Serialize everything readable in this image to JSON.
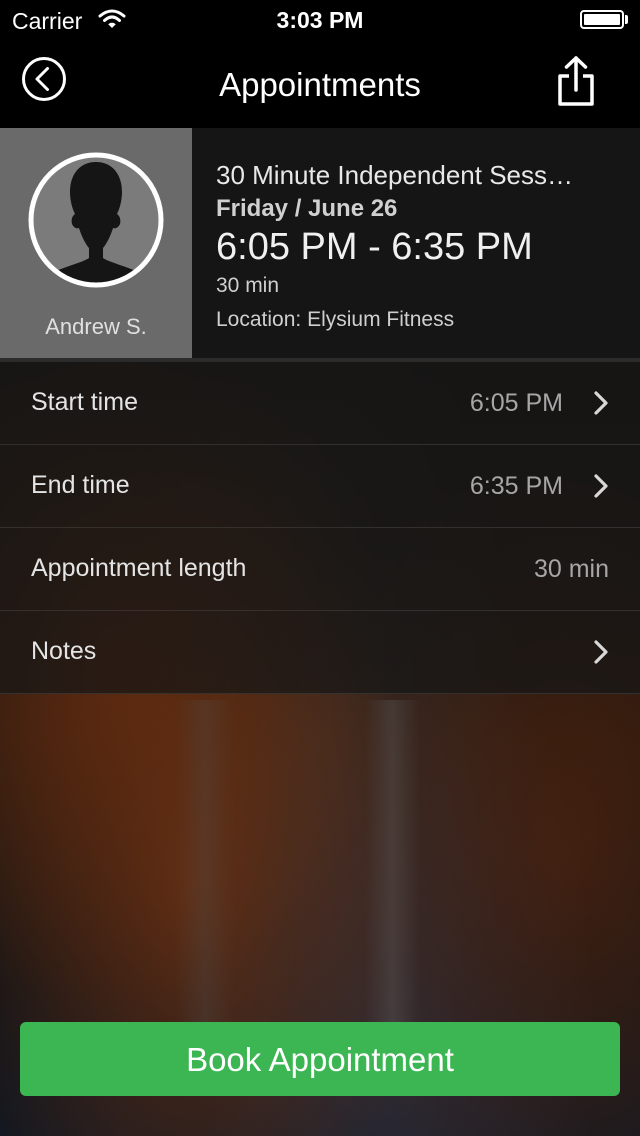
{
  "status_bar": {
    "carrier": "Carrier",
    "time": "3:03 PM"
  },
  "nav": {
    "title": "Appointments",
    "back_icon": "circle-chevron-left-icon",
    "share_icon": "share-icon"
  },
  "appointment": {
    "trainer_name": "Andrew S.",
    "title": "30 Minute Independent Sess…",
    "date": "Friday / June 26",
    "time_range": "6:05 PM - 6:35 PM",
    "length": "30 min",
    "location": "Location: Elysium Fitness"
  },
  "details": [
    {
      "label": "Start time",
      "value": "6:05 PM",
      "has_chevron": true
    },
    {
      "label": "End time",
      "value": "6:35 PM",
      "has_chevron": true
    },
    {
      "label": "Appointment length",
      "value": "30 min",
      "has_chevron": false
    },
    {
      "label": "Notes",
      "value": "",
      "has_chevron": true
    }
  ],
  "book_button_label": "Book Appointment",
  "colors": {
    "accent_green": "#3cb653",
    "nav_background": "#000000",
    "avatar_panel": "#6a6a6a"
  }
}
